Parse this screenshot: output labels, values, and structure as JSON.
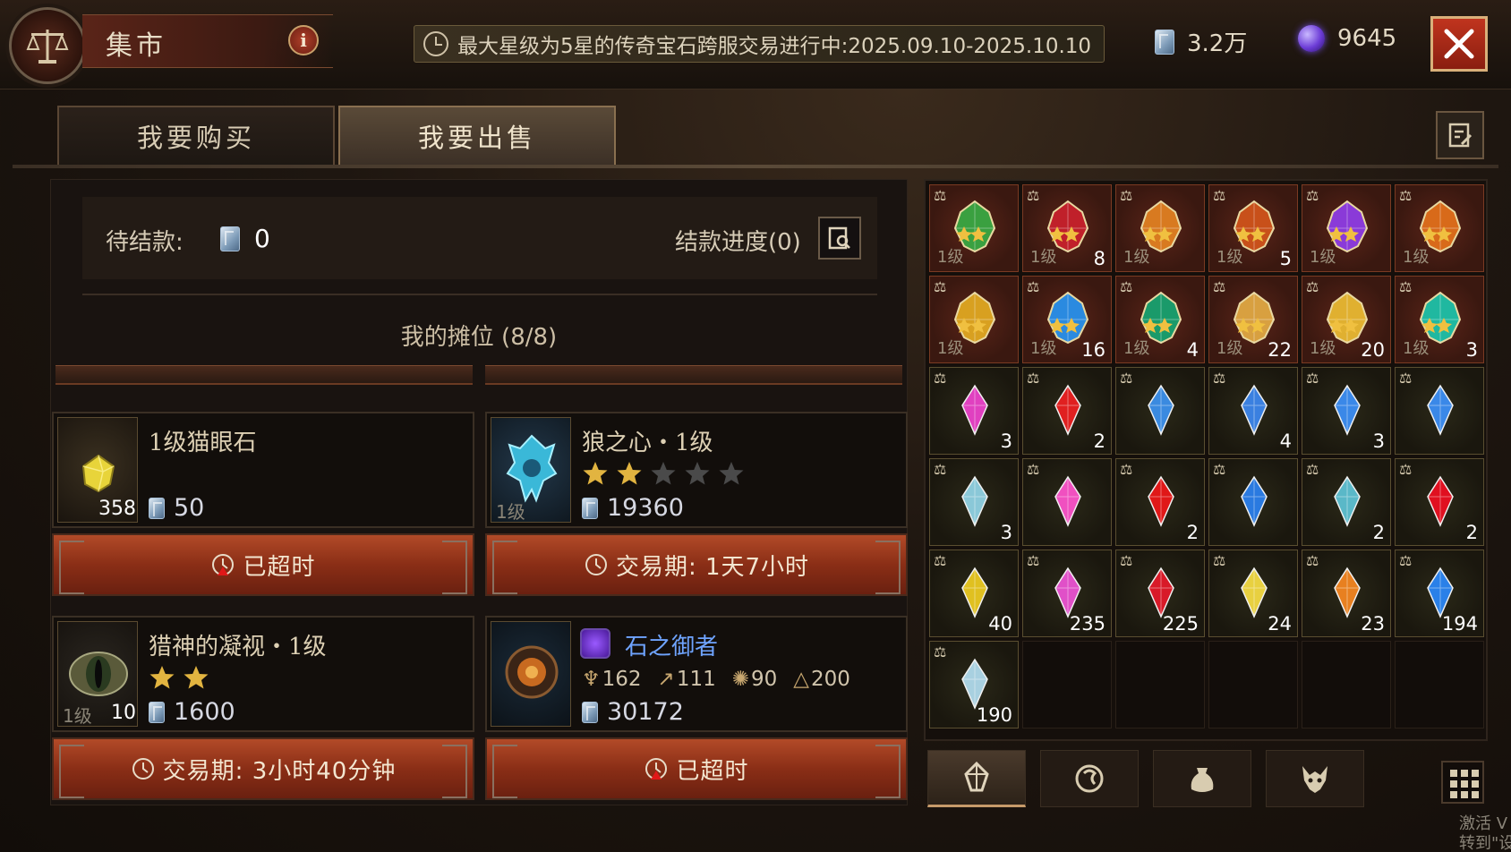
{
  "header": {
    "title": "集市",
    "info_label": "i",
    "banner": "最大星级为5星的传奇宝石跨服交易进行中:2025.09.10-2025.10.10",
    "currency_crystal": "3.2万",
    "currency_orb": "9645"
  },
  "tabs": [
    {
      "label": "我要购买",
      "active": false
    },
    {
      "label": "我要出售",
      "active": true
    }
  ],
  "pending": {
    "label": "待结款:",
    "value": "0",
    "progress_label": "结款进度(0)"
  },
  "stall": {
    "title": "我的摊位 (8/8)"
  },
  "listings": [
    {
      "name": "1级猫眼石",
      "quantity": "358",
      "price": "50",
      "stars": 0,
      "button": "已超时",
      "button_icon": "alarm-icon"
    },
    {
      "name": "狼之心・1级",
      "level_label": "1级",
      "price": "19360",
      "stars": 2,
      "max_stars": 5,
      "button": "交易期:  1天7小时",
      "button_icon": "clock-icon"
    },
    {
      "name": "猎神的凝视・1级",
      "level_label": "1级",
      "quantity": "10",
      "price": "1600",
      "stars": 2,
      "button": "交易期:  3小时40分钟",
      "button_icon": "clock-icon"
    },
    {
      "name": "石之御者",
      "price": "30172",
      "stats": [
        "162",
        "111",
        "90",
        "200"
      ],
      "button": "已超时",
      "button_icon": "alarm-icon"
    }
  ],
  "inventory": [
    {
      "kind": "legendary",
      "level": "1级",
      "count": "",
      "color": "#3aa040"
    },
    {
      "kind": "legendary",
      "level": "1级",
      "count": "8",
      "color": "#c0202a"
    },
    {
      "kind": "legendary",
      "level": "1级",
      "count": "",
      "color": "#d87a20"
    },
    {
      "kind": "legendary",
      "level": "1级",
      "count": "5",
      "color": "#c8501a"
    },
    {
      "kind": "legendary",
      "level": "1级",
      "count": "",
      "color": "#8a3ad8"
    },
    {
      "kind": "legendary",
      "level": "1级",
      "count": "",
      "color": "#d86a1a"
    },
    {
      "kind": "legendary",
      "level": "1级",
      "count": "",
      "color": "#d8a020"
    },
    {
      "kind": "legendary",
      "level": "1级",
      "count": "16",
      "color": "#2a8ae0"
    },
    {
      "kind": "legendary",
      "level": "1级",
      "count": "4",
      "color": "#1a9a6a"
    },
    {
      "kind": "legendary",
      "level": "1级",
      "count": "22",
      "color": "#d8a040"
    },
    {
      "kind": "legendary",
      "level": "1级",
      "count": "20",
      "color": "#e0b030"
    },
    {
      "kind": "legendary",
      "level": "1级",
      "count": "3",
      "color": "#20b8a0"
    },
    {
      "kind": "gem",
      "count": "3",
      "color": "#e040c0"
    },
    {
      "kind": "gem",
      "count": "2",
      "color": "#e02020"
    },
    {
      "kind": "gem",
      "count": "",
      "color": "#3a8ae0"
    },
    {
      "kind": "gem",
      "count": "4",
      "color": "#3a80e0"
    },
    {
      "kind": "gem",
      "count": "3",
      "color": "#3a88e8"
    },
    {
      "kind": "gem",
      "count": "",
      "color": "#3a88e8"
    },
    {
      "kind": "gem",
      "count": "3",
      "color": "#8ac8d8"
    },
    {
      "kind": "gem",
      "count": "",
      "color": "#f050c0"
    },
    {
      "kind": "gem",
      "count": "2",
      "color": "#e01818"
    },
    {
      "kind": "gem",
      "count": "",
      "color": "#2a7ae0"
    },
    {
      "kind": "gem",
      "count": "2",
      "color": "#5ab8c8"
    },
    {
      "kind": "gem",
      "count": "2",
      "color": "#e01020"
    },
    {
      "kind": "gem",
      "count": "40",
      "color": "#e0c020"
    },
    {
      "kind": "gem",
      "count": "235",
      "color": "#e050c8"
    },
    {
      "kind": "gem",
      "count": "225",
      "color": "#d81a28"
    },
    {
      "kind": "gem",
      "count": "24",
      "color": "#e8d040"
    },
    {
      "kind": "gem",
      "count": "23",
      "color": "#e88020"
    },
    {
      "kind": "gem",
      "count": "194",
      "color": "#2a80e8"
    },
    {
      "kind": "gem",
      "count": "190",
      "color": "#a8d0e0"
    }
  ],
  "bottom_tabs": [
    "gem-tab-icon",
    "rune-tab-icon",
    "bag-tab-icon",
    "demon-tab-icon"
  ],
  "watermark": {
    "line1": "激活 V",
    "line2": "转到\"设置"
  }
}
